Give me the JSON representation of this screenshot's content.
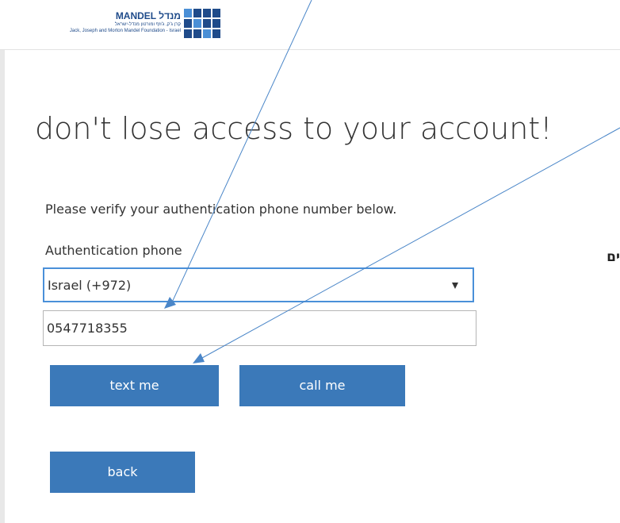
{
  "header": {
    "logo_name": "MANDEL מנדל",
    "logo_hebrew": "קרן ג'ק, ג'וזף ומורטון מנדל-ישראל",
    "logo_english": "Jack, Joseph and Morton Mandel Foundation - Israel",
    "logo_colors": [
      "#4a8fd6",
      "#1f4b8a",
      "#1f4b8a",
      "#1f4b8a",
      "#1f4b8a",
      "#4a8fd6",
      "#1f4b8a",
      "#1f4b8a",
      "#1f4b8a",
      "#1f4b8a",
      "#4a8fd6",
      "#1f4b8a"
    ]
  },
  "main": {
    "title": "don't lose access to your account!",
    "instruction": "Please verify your authentication phone number below.",
    "phone_label": "Authentication phone",
    "country_select": {
      "selected": "Israel (+972)",
      "caret": "caret-down-icon"
    },
    "phone_number": "0547718355",
    "buttons": {
      "text_me": "text me",
      "call_me": "call me",
      "back": "back"
    }
  },
  "side_text": "ים",
  "colors": {
    "primary_button": "#3b79b9",
    "focus_border": "#4a90d9",
    "text": "#333333",
    "annotation_arrow": "#4a86c8"
  }
}
